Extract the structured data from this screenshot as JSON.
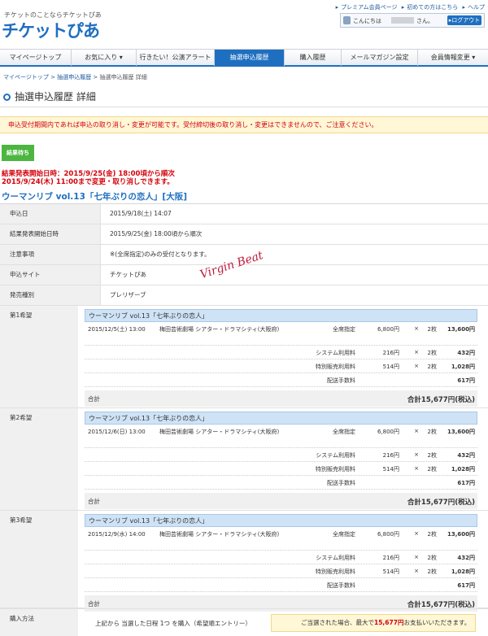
{
  "header": {
    "tagline": "チケットのことならチケットぴあ",
    "logo": "チケットぴあ",
    "links": [
      "プレミアム会員ページ",
      "初めての方はこちら",
      "ヘルプ"
    ],
    "greeting": "こんにちは",
    "greeting_suffix": "さん。",
    "login_button": "ログアウト"
  },
  "nav": {
    "tabs": [
      {
        "label": "マイページトップ"
      },
      {
        "label": "お気に入り ▾"
      },
      {
        "label": "行きたい！公演アラート"
      },
      {
        "label": "抽選申込履歴"
      },
      {
        "label": "購入履歴"
      },
      {
        "label": "メールマガジン設定"
      },
      {
        "label": "会員情報変更 ▾"
      }
    ]
  },
  "breadcrumb": {
    "items": [
      "マイページトップ",
      "抽選申込履歴"
    ],
    "current": "抽選申込履歴 詳細"
  },
  "page_title": "抽選申込履歴 詳細",
  "notice": "申込受付期間内であれば申込の取り消し・変更が可能です。受付締切後の取り消し・変更はできませんので、ご注意ください。",
  "status_badge": "結果待ち",
  "result_lines": [
    "結果発表開始日時：2015/9/25(金) 18:00頃から順次",
    "2015/9/24(木) 11:00まで変更・取り消しできます。"
  ],
  "event_title": "ウーマンリブ vol.13「七年ぶりの恋人」[大阪]",
  "info_rows": [
    {
      "label": "申込日",
      "value": "2015/9/18(土) 14:07"
    },
    {
      "label": "結果発表開始日時",
      "value": "2015/9/25(金) 18:00頃から順次"
    },
    {
      "label": "注意事項",
      "value": "※(全席指定)のみの受付となります。"
    },
    {
      "label": "申込サイト",
      "value": "チケットぴあ"
    },
    {
      "label": "発売種別",
      "value": "プレリザーブ"
    }
  ],
  "watermark": "Virgin Beat",
  "wishes": [
    {
      "label": "第1希望",
      "perf": "ウーマンリブ vol.13「七年ぶりの恋人」",
      "date": "2015/12/5(土) 13:00",
      "venue": "梅田芸術劇場 シアター・ドラマシティ(大阪府)",
      "seat": "全席指定",
      "price": "6,800円",
      "times": "×",
      "qty": "2枚",
      "amount": "13,600円",
      "fees": [
        {
          "name": "システム利用料",
          "price": "216円",
          "times": "×",
          "qty": "2枚",
          "amount": "432円"
        },
        {
          "name": "特別販売利用料",
          "price": "514円",
          "times": "×",
          "qty": "2枚",
          "amount": "1,028円"
        },
        {
          "name": "配送手数料",
          "price": "",
          "times": "",
          "qty": "",
          "amount": "617円"
        }
      ],
      "total_label": "合計",
      "total": "合計15,677円(税込)"
    },
    {
      "label": "第2希望",
      "perf": "ウーマンリブ vol.13「七年ぶりの恋人」",
      "date": "2015/12/6(日) 13:00",
      "venue": "梅田芸術劇場 シアター・ドラマシティ(大阪府)",
      "seat": "全席指定",
      "price": "6,800円",
      "times": "×",
      "qty": "2枚",
      "amount": "13,600円",
      "fees": [
        {
          "name": "システム利用料",
          "price": "216円",
          "times": "×",
          "qty": "2枚",
          "amount": "432円"
        },
        {
          "name": "特別販売利用料",
          "price": "514円",
          "times": "×",
          "qty": "2枚",
          "amount": "1,028円"
        },
        {
          "name": "配送手数料",
          "price": "",
          "times": "",
          "qty": "",
          "amount": "617円"
        }
      ],
      "total_label": "合計",
      "total": "合計15,677円(税込)"
    },
    {
      "label": "第3希望",
      "perf": "ウーマンリブ vol.13「七年ぶりの恋人」",
      "date": "2015/12/9(水) 14:00",
      "venue": "梅田芸術劇場 シアター・ドラマシティ(大阪府)",
      "seat": "全席指定",
      "price": "6,800円",
      "times": "×",
      "qty": "2枚",
      "amount": "13,600円",
      "fees": [
        {
          "name": "システム利用料",
          "price": "216円",
          "times": "×",
          "qty": "2枚",
          "amount": "432円"
        },
        {
          "name": "特別販売利用料",
          "price": "514円",
          "times": "×",
          "qty": "2枚",
          "amount": "1,028円"
        },
        {
          "name": "配送手数料",
          "price": "",
          "times": "",
          "qty": "",
          "amount": "617円"
        }
      ],
      "total_label": "合計",
      "total": "合計15,677円(税込)"
    }
  ],
  "purchase_method": {
    "label": "購入方法",
    "text": "上記から 当選した日程 1つ を購入（希望順エントリー）",
    "note_before": "ご当選された場合、最大で",
    "note_amount": "15,677円",
    "note_after": "お支払いいただきます。"
  },
  "colors": {
    "accent": "#1f6fc0",
    "alert": "#d4000a",
    "status": "#4cb640",
    "notice_bg": "#fff7d6"
  }
}
